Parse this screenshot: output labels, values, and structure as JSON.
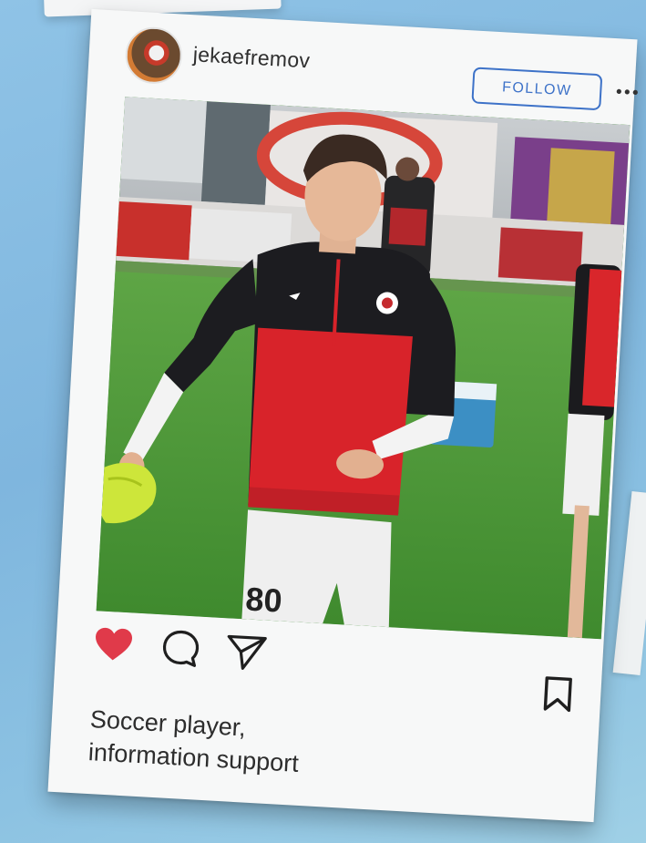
{
  "post": {
    "username": "jekaefremov",
    "follow_label": "FOLLOW",
    "caption_lines": [
      "Soccer player,",
      "information support"
    ],
    "liked": true
  },
  "icons": {
    "avatar": "profile-photo",
    "more": "ellipsis-icon",
    "like": "heart-icon",
    "comment": "comment-bubble-icon",
    "share": "paper-plane-icon",
    "save": "bookmark-icon"
  },
  "colors": {
    "accent": "#3d72c8",
    "like": "#e03a4a",
    "background": "#86bde3",
    "card": "#f7f8f8"
  }
}
